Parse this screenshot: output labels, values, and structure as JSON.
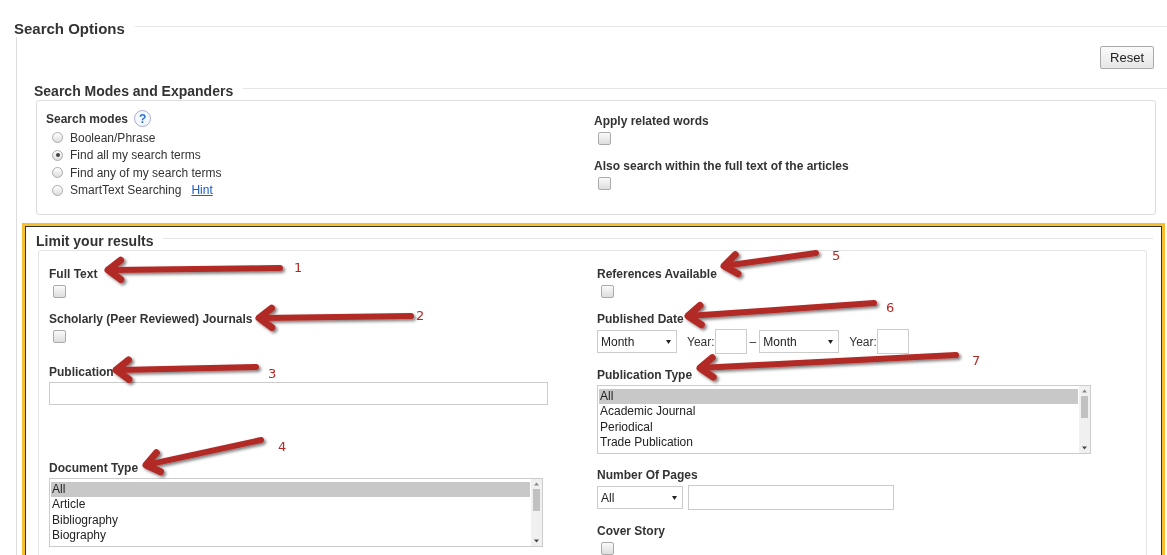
{
  "title": "Search Options",
  "reset_button": "Reset",
  "modes_section": {
    "title": "Search Modes and Expanders",
    "search_modes": {
      "label": "Search modes",
      "help": "?",
      "options": [
        {
          "label": "Boolean/Phrase",
          "selected": false
        },
        {
          "label": "Find all my search terms",
          "selected": true
        },
        {
          "label": "Find any of my search terms",
          "selected": false
        },
        {
          "label": "SmartText Searching",
          "selected": false,
          "link": "Hint"
        }
      ]
    },
    "expanders": [
      {
        "label": "Apply related words",
        "checked": false
      },
      {
        "label": "Also search within the full text of the articles",
        "checked": false
      }
    ]
  },
  "limits_section": {
    "title": "Limit your results",
    "left": [
      {
        "kind": "checkbox",
        "label": "Full Text",
        "checked": false
      },
      {
        "kind": "checkbox",
        "label": "Scholarly (Peer Reviewed) Journals",
        "checked": false
      },
      {
        "kind": "text",
        "label": "Publication"
      },
      {
        "kind": "list",
        "label": "Document Type",
        "items": [
          {
            "label": "All",
            "selected": true
          },
          {
            "label": "Article",
            "selected": false
          },
          {
            "label": "Bibliography",
            "selected": false
          },
          {
            "label": "Biography",
            "selected": false
          }
        ]
      }
    ],
    "right": [
      {
        "kind": "checkbox",
        "label": "References Available",
        "checked": false
      },
      {
        "kind": "date",
        "label": "Published Date",
        "from_month": "Month",
        "from_year_label": "Year:",
        "separator": "–",
        "to_month": "Month",
        "to_year_label": "Year:"
      },
      {
        "kind": "list",
        "label": "Publication Type",
        "items": [
          {
            "label": "All",
            "selected": true
          },
          {
            "label": "Academic Journal",
            "selected": false
          },
          {
            "label": "Periodical",
            "selected": false
          },
          {
            "label": "Trade Publication",
            "selected": false
          }
        ]
      },
      {
        "kind": "pages",
        "label": "Number Of Pages",
        "select": "All"
      },
      {
        "kind": "checkbox",
        "label": "Cover Story",
        "checked": false
      }
    ]
  },
  "annotations": [
    "1",
    "2",
    "3",
    "4",
    "5",
    "6",
    "7"
  ]
}
